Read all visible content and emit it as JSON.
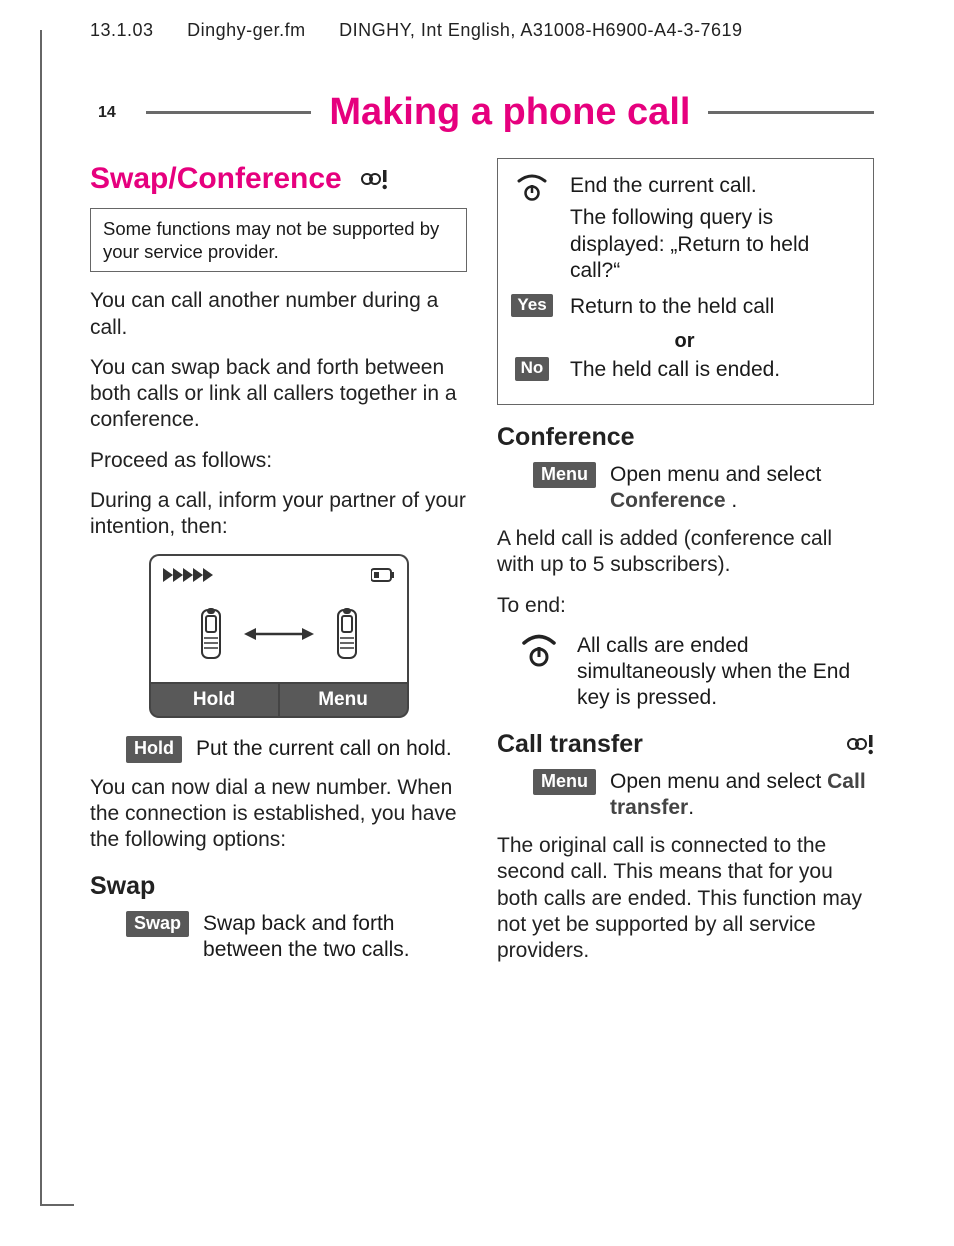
{
  "header": {
    "date": "13.1.03",
    "file": "Dinghy-ger.fm",
    "doc": "DINGHY, Int English, A31008-H6900-A4-3-7619"
  },
  "page_number": "14",
  "title": "Making a phone call",
  "left": {
    "section_heading": "Swap/Conference",
    "note": "Some functions may not be supported by your service provider.",
    "p1": "You can call another number during a call.",
    "p2": "You can swap back and forth between both calls or link all callers together in a conference.",
    "p3": "Proceed as follows:",
    "p4": "During a call, inform your partner of your intention, then:",
    "soft_left": "Hold",
    "soft_right": "Menu",
    "hold_pill": "Hold",
    "hold_text": "Put the current call on hold.",
    "p5": "You can now dial a new number. When the connection is established, you have the following options:",
    "swap_heading": "Swap",
    "swap_pill": "Swap",
    "swap_text": "Swap back and forth between the two calls."
  },
  "right": {
    "box": {
      "end_text": "End the current call.",
      "query_text": "The following query is displayed: „Return to held call?“",
      "yes_pill": "Yes",
      "yes_text": "Return to the held call",
      "or": "or",
      "no_pill": "No",
      "no_text": "The held call is ended."
    },
    "conf_heading": "Conference",
    "conf_pill": "Menu",
    "conf_text_a": "Open menu and select ",
    "conf_text_b": "Conference ",
    "conf_text_c": ".",
    "conf_p1": "A held call is added (conference call with up to 5 subscribers).",
    "conf_p2": "To end:",
    "conf_end_text": "All calls are ended simultaneously when the End key is pressed.",
    "ct_heading": "Call transfer",
    "ct_pill": "Menu",
    "ct_text_a": "Open menu and select ",
    "ct_text_b": "Call transfer",
    "ct_text_c": ".",
    "ct_p1": "The original call is connected to the second call. This means that for you both calls are ended. This function may not yet be supported by all service providers."
  }
}
